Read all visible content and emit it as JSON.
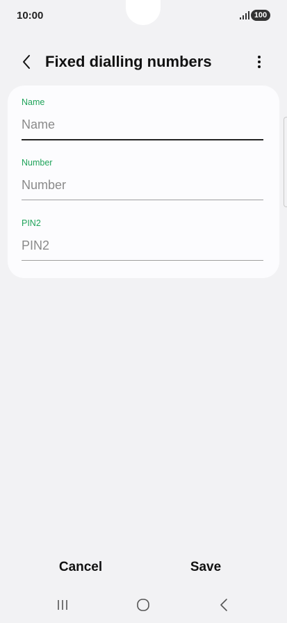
{
  "status_bar": {
    "time": "10:00",
    "battery": "100",
    "icons": [
      "signal-icon"
    ]
  },
  "header": {
    "title": "Fixed dialling numbers",
    "back_icon": "chevron-left-icon",
    "menu_icon": "more-vertical-icon"
  },
  "form": {
    "fields": [
      {
        "label": "Name",
        "value": "",
        "placeholder": "Name"
      },
      {
        "label": "Number",
        "value": "",
        "placeholder": "Number"
      },
      {
        "label": "PIN2",
        "value": "",
        "placeholder": "PIN2"
      }
    ]
  },
  "actions": {
    "cancel_label": "Cancel",
    "save_label": "Save"
  },
  "nav": {
    "icons": [
      "recent-apps-icon",
      "home-icon",
      "back-icon"
    ]
  },
  "colors": {
    "background": "#f2f2f4",
    "card": "#fcfcfe",
    "accent": "#1fa35a",
    "text": "#111111"
  }
}
